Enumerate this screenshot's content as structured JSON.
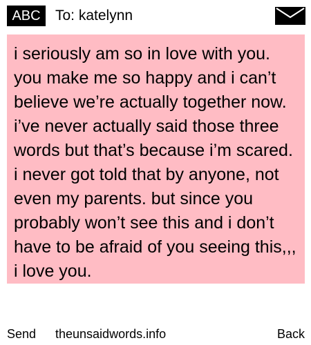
{
  "header": {
    "mode_badge": "ABC",
    "to_label": "To:",
    "recipient": "katelynn",
    "envelope_icon": "envelope-icon"
  },
  "message": {
    "text": "i seriously am so in love with you. you make me so happy and i can’t believe we’re actually together now. i’ve never actually said those three words but that’s because i’m scared. i never got told that by anyone, not even my parents. but since you probably won’t see this and i don’t have to be afraid of you seeing this,,, i love you."
  },
  "colors": {
    "message_background": "#ffbcc4",
    "badge_background": "#000000",
    "badge_text": "#ffffff"
  },
  "footer": {
    "send_label": "Send",
    "site_label": "theunsaidwords.info",
    "back_label": "Back"
  }
}
